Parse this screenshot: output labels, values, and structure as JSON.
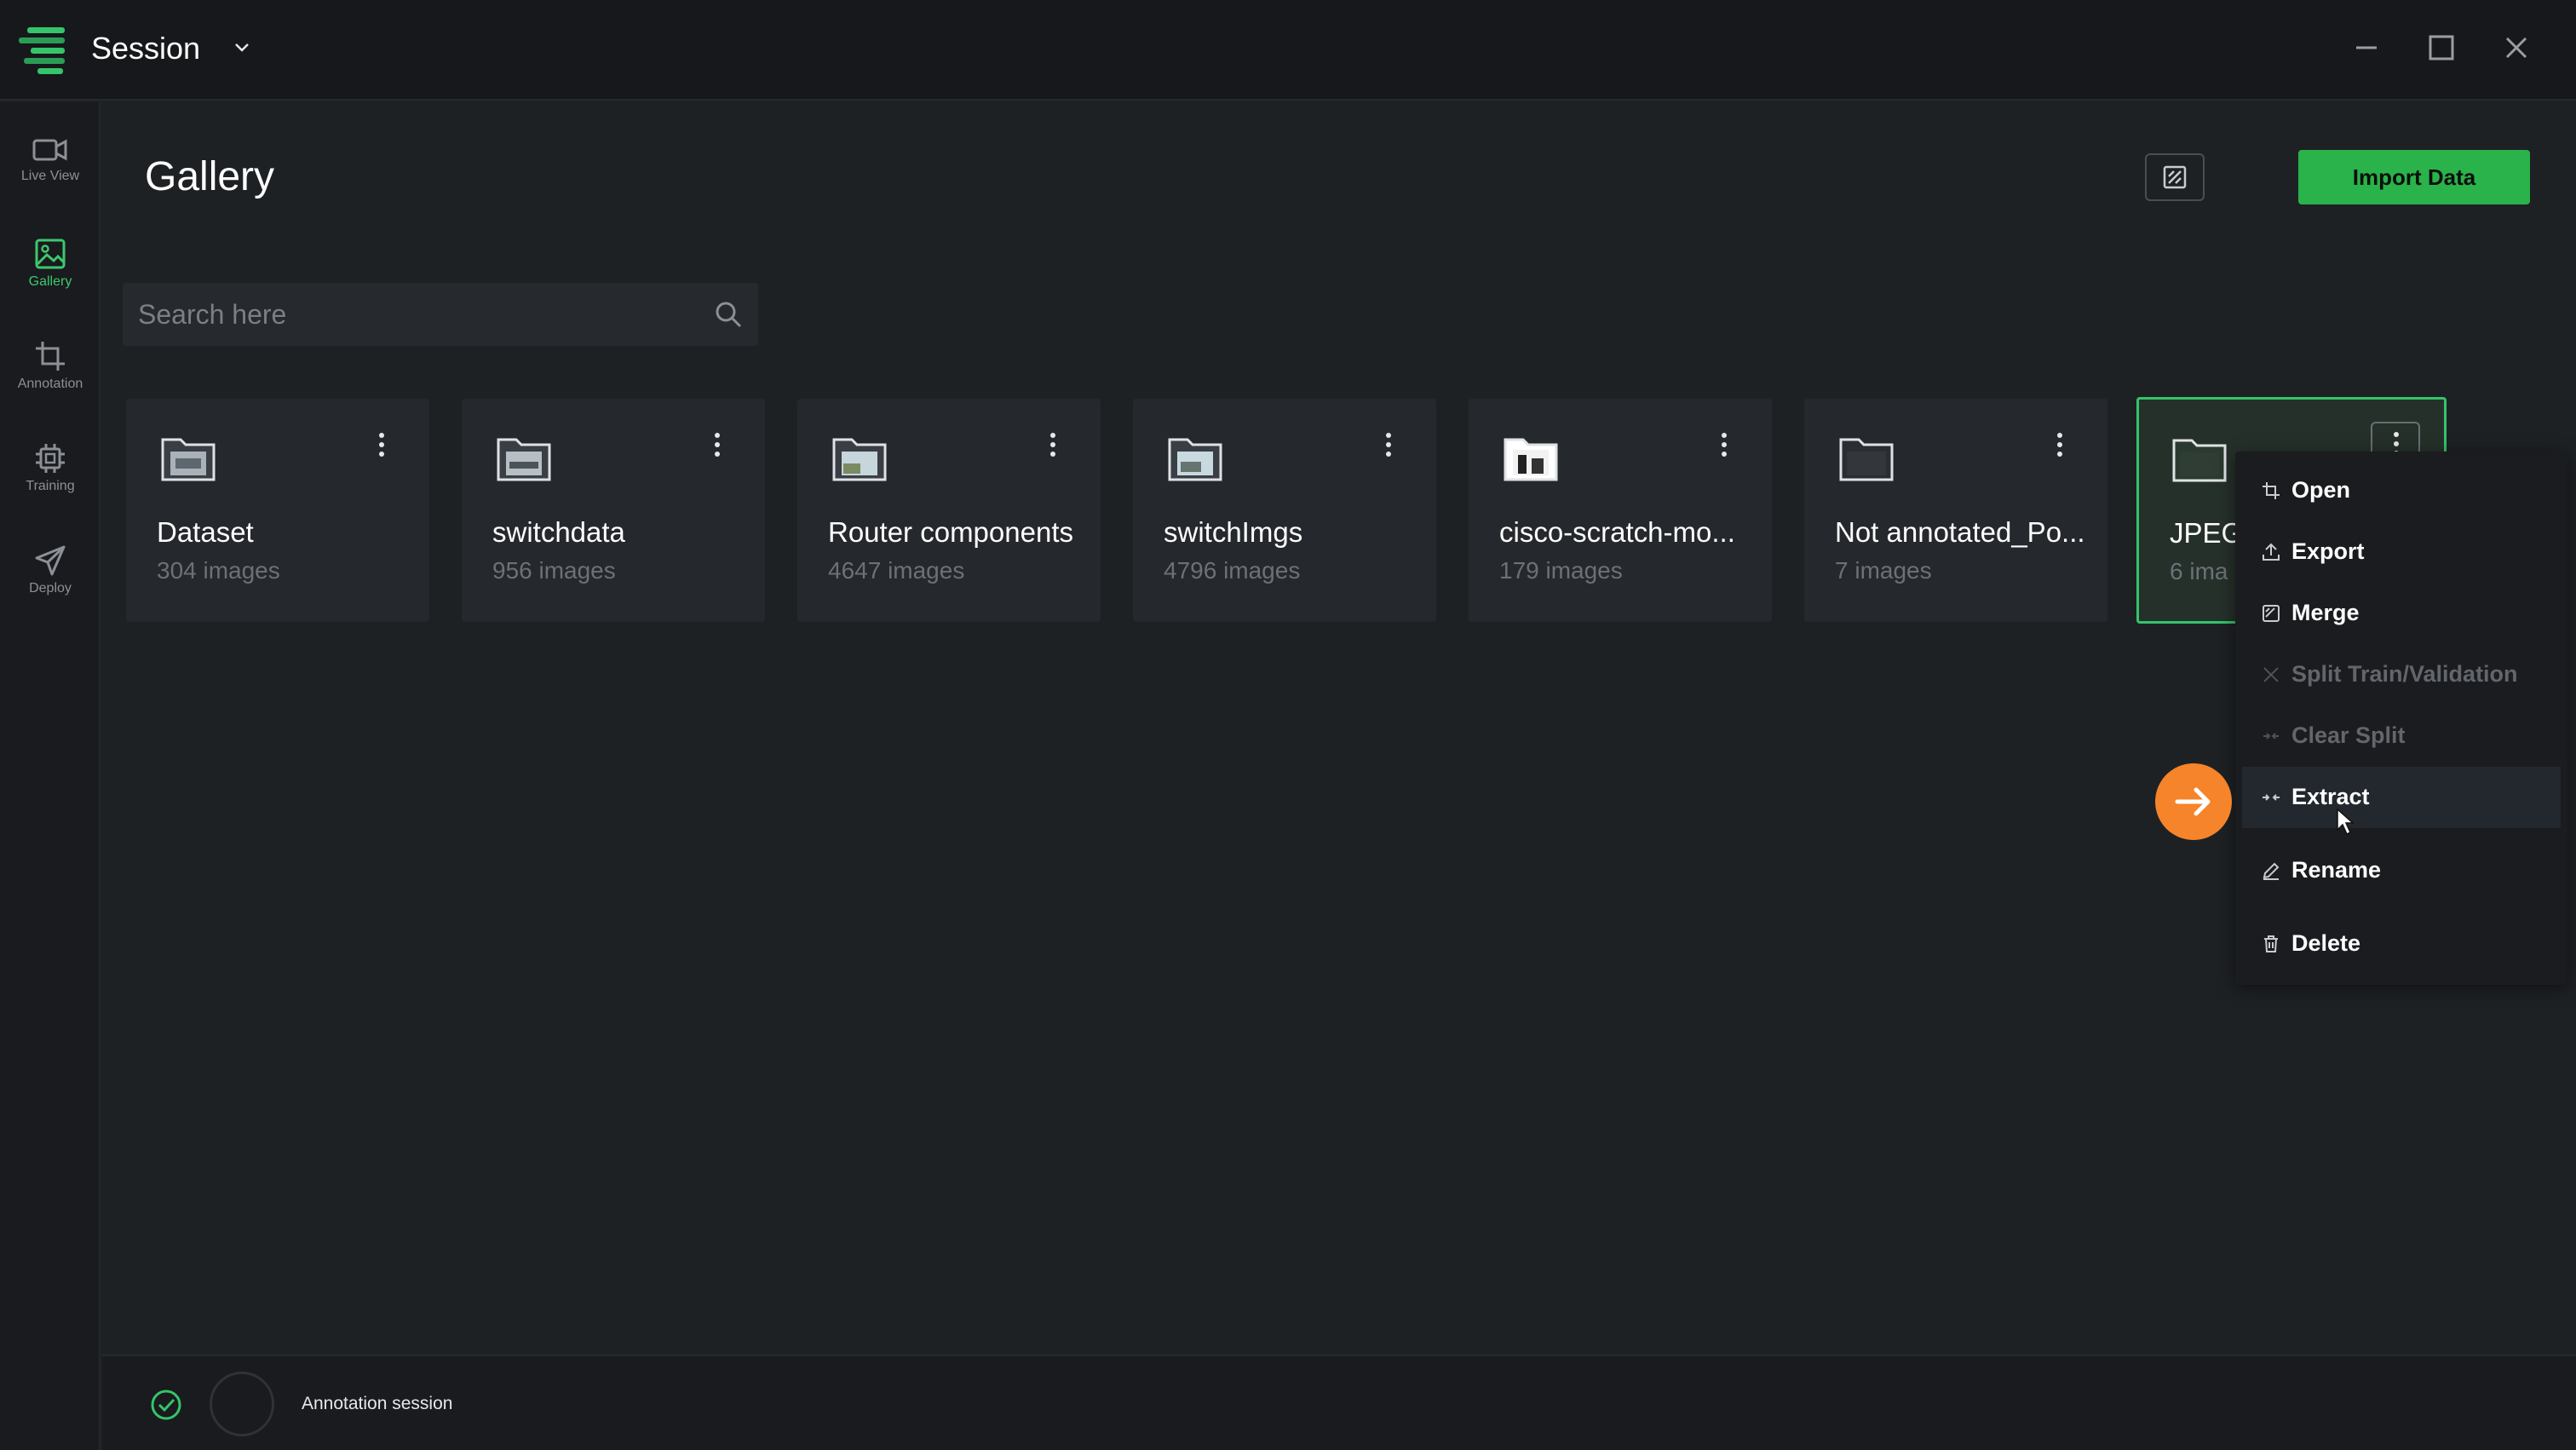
{
  "app": {
    "title": "Session"
  },
  "sidebar": {
    "items": [
      {
        "label": "Live View",
        "icon": "video-camera-icon",
        "active": false
      },
      {
        "label": "Gallery",
        "icon": "image-icon",
        "active": true
      },
      {
        "label": "Annotation",
        "icon": "crop-icon",
        "active": false
      },
      {
        "label": "Training",
        "icon": "cpu-chip-icon",
        "active": false
      },
      {
        "label": "Deploy",
        "icon": "paper-plane-icon",
        "active": false
      }
    ]
  },
  "main": {
    "title": "Gallery",
    "import_label": "Import Data",
    "search_placeholder": "Search here"
  },
  "folders": [
    {
      "name": "Dataset",
      "count": "304 images",
      "thumb": "image"
    },
    {
      "name": "switchdata",
      "count": "956 images",
      "thumb": "image"
    },
    {
      "name": "Router components",
      "count": "4647 images",
      "thumb": "image"
    },
    {
      "name": "switchImgs",
      "count": "4796 images",
      "thumb": "image"
    },
    {
      "name": "cisco-scratch-mo...",
      "count": "179 images",
      "thumb": "image"
    },
    {
      "name": "Not annotated_Po...",
      "count": "7 images",
      "thumb": "empty"
    },
    {
      "name": "JPEG",
      "count": "6 ima",
      "thumb": "empty",
      "selected": true
    }
  ],
  "context_menu": {
    "items": [
      {
        "label": "Open",
        "icon": "open-icon",
        "disabled": false
      },
      {
        "label": "Export",
        "icon": "upload-icon",
        "disabled": false
      },
      {
        "label": "Merge",
        "icon": "merge-icon",
        "disabled": false
      },
      {
        "label": "Split Train/Validation",
        "icon": "split-icon",
        "disabled": true
      },
      {
        "label": "Clear Split",
        "icon": "clear-split-icon",
        "disabled": true
      },
      {
        "label": "Extract",
        "icon": "extract-icon",
        "disabled": false,
        "highlighted": true
      },
      {
        "label": "Rename",
        "icon": "pencil-icon",
        "disabled": false
      },
      {
        "label": "Delete",
        "icon": "trash-icon",
        "disabled": false
      }
    ]
  },
  "status": {
    "text": "Annotation session"
  },
  "colors": {
    "accent": "#35c46a",
    "button": "#2ab34a",
    "pointer": "#f5842a"
  }
}
